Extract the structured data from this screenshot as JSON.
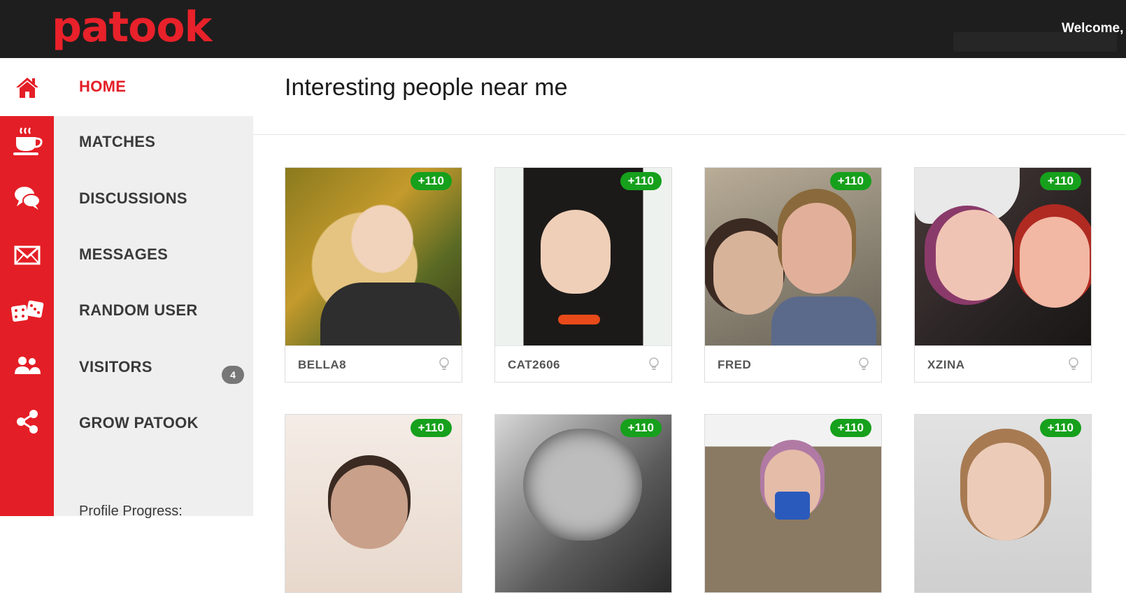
{
  "header": {
    "logo": "patook",
    "welcome": "Welcome,"
  },
  "sidebar": {
    "items": [
      {
        "label": "HOME",
        "icon": "home-icon"
      },
      {
        "label": "MATCHES",
        "icon": "coffee-cup-icon"
      },
      {
        "label": "DISCUSSIONS",
        "icon": "chat-bubbles-icon"
      },
      {
        "label": "MESSAGES",
        "icon": "envelope-icon"
      },
      {
        "label": "RANDOM USER",
        "icon": "dice-icon"
      },
      {
        "label": "VISITORS",
        "icon": "users-icon",
        "badge": "4"
      },
      {
        "label": "GROW PATOOK",
        "icon": "share-icon"
      }
    ],
    "profile_progress_label": "Profile Progress:"
  },
  "main": {
    "title": "Interesting people near me",
    "people": [
      {
        "username": "BELLA8",
        "points": "+110"
      },
      {
        "username": "CAT2606",
        "points": "+110"
      },
      {
        "username": "FRED",
        "points": "+110"
      },
      {
        "username": "XZINA",
        "points": "+110"
      },
      {
        "username": "",
        "points": "+110"
      },
      {
        "username": "",
        "points": "+110"
      },
      {
        "username": "",
        "points": "+110"
      },
      {
        "username": "",
        "points": "+110"
      }
    ]
  },
  "colors": {
    "brand_red": "#e41e26",
    "topbar": "#1e1e1e",
    "points_green": "#16a01c"
  }
}
